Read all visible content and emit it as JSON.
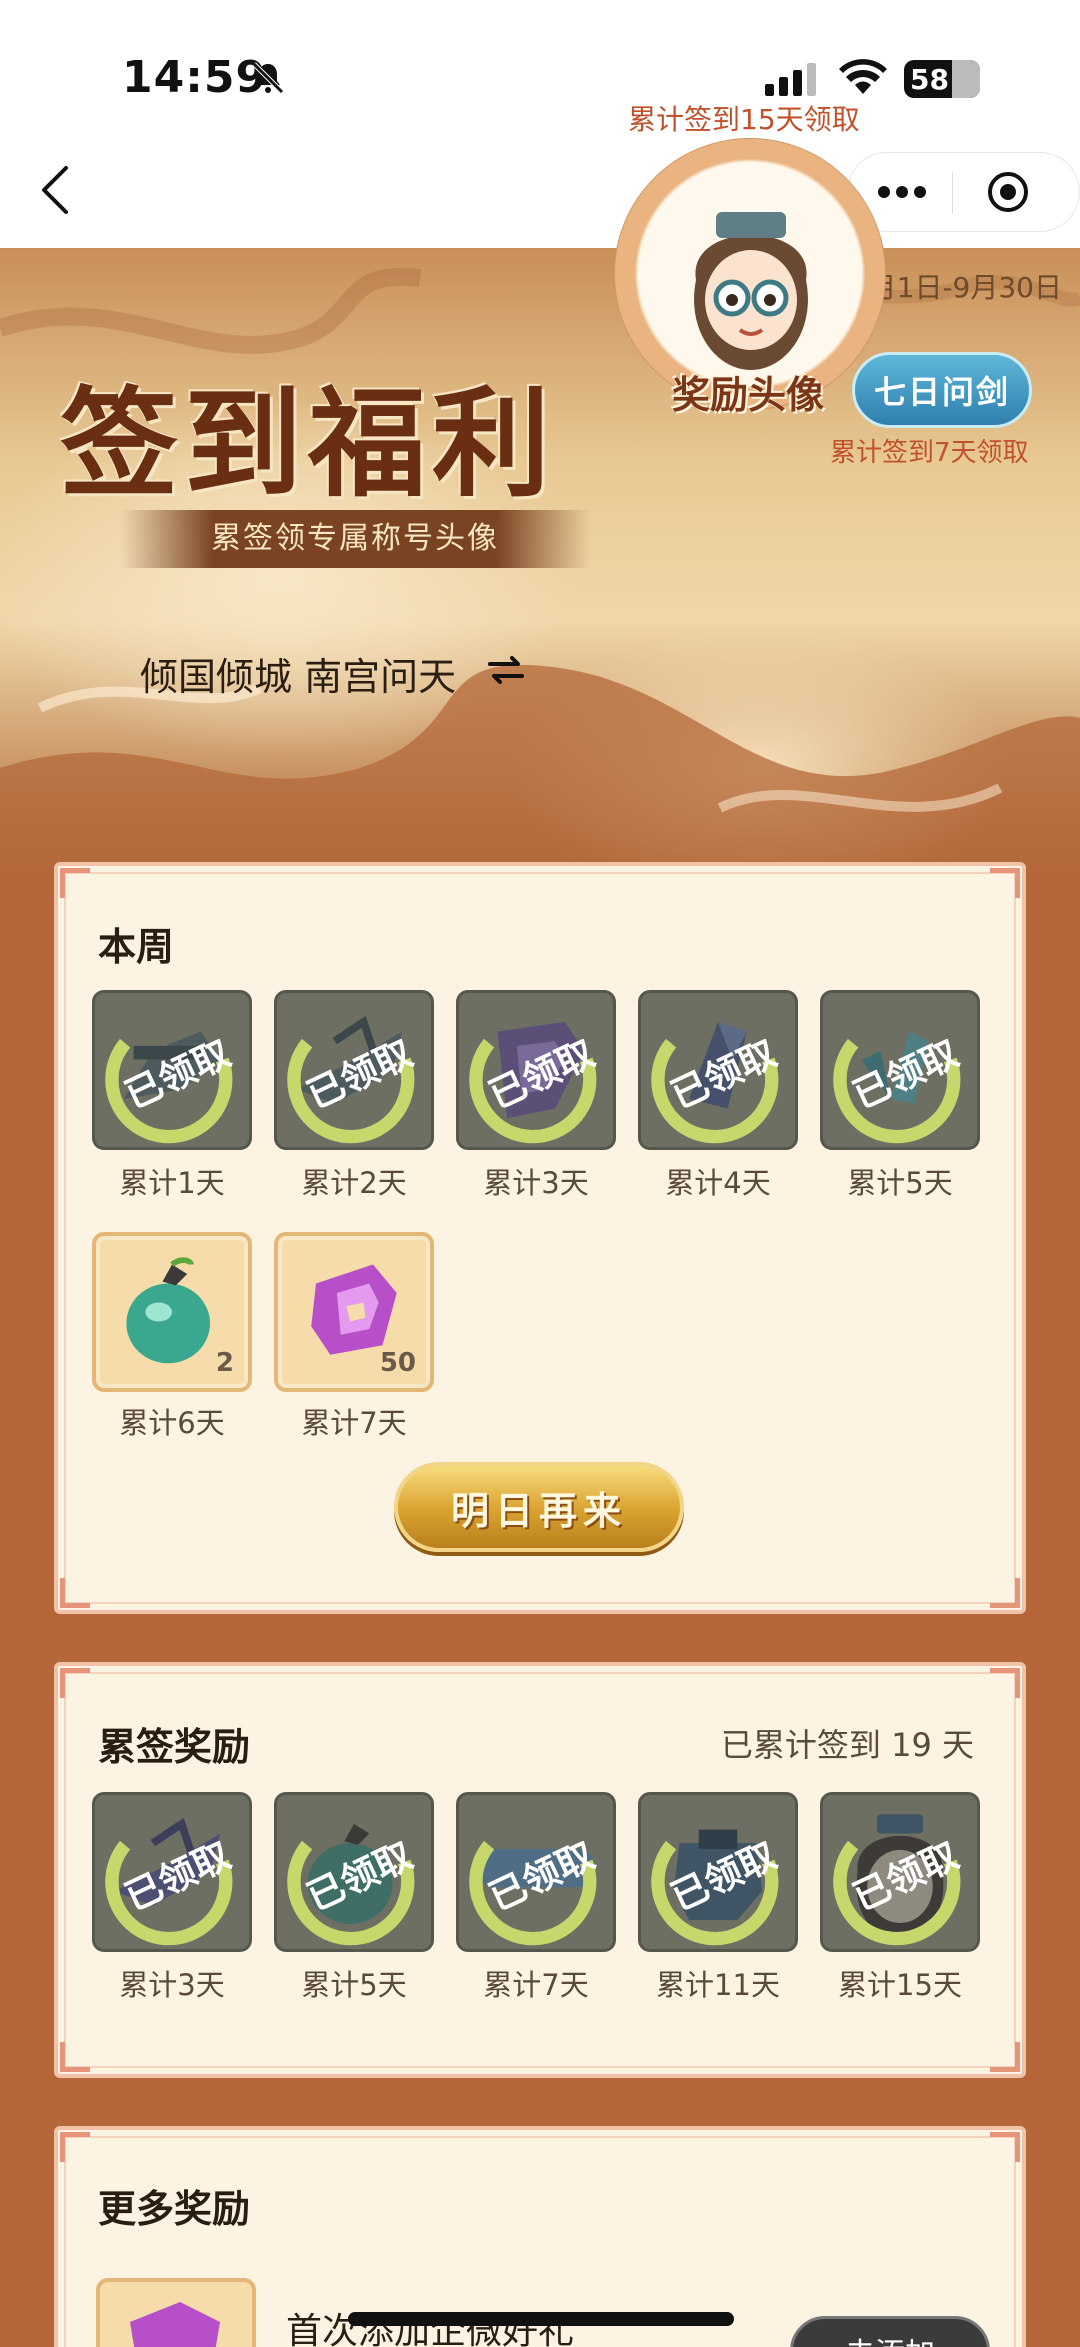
{
  "status_bar": {
    "time": "14:59",
    "battery": "58"
  },
  "banner": {
    "activity_time": "本期活动时间：9月1日-9月30日",
    "title": "签到福利",
    "subtitle": "累签领专属称号头像",
    "player_name": "倾国倾城  南宫问天",
    "avatar_note_top": "累计签到15天领取",
    "avatar_label": "奖励头像",
    "title_badge": "七日问剑",
    "avatar_note_bottom": "累计签到7天领取"
  },
  "weekly": {
    "title": "本周",
    "items": [
      {
        "label": "累计1天",
        "state": "claimed",
        "icon": "gray-sword-icon",
        "stamp": "已领取"
      },
      {
        "label": "累计2天",
        "state": "claimed",
        "icon": "gray-sword-icon",
        "stamp": "已领取"
      },
      {
        "label": "累计3天",
        "state": "claimed",
        "icon": "purple-gem-icon",
        "stamp": "已领取"
      },
      {
        "label": "累计4天",
        "state": "claimed",
        "icon": "crystal-icon",
        "stamp": "已领取"
      },
      {
        "label": "累计5天",
        "state": "claimed",
        "icon": "teal-crystal-icon",
        "stamp": "已领取"
      },
      {
        "label": "累计6天",
        "state": "pending",
        "icon": "green-pouch-icon",
        "qty": "2"
      },
      {
        "label": "累计7天",
        "state": "pending",
        "icon": "purple-gem-icon",
        "qty": "50"
      }
    ],
    "cta": "明日再来"
  },
  "cumulative": {
    "title": "累签奖励",
    "summary": "已累计签到 19 天",
    "items": [
      {
        "label": "累计3天",
        "stamp": "已领取",
        "icon": "gray-sword-icon"
      },
      {
        "label": "累计5天",
        "stamp": "已领取",
        "icon": "green-pouch-icon"
      },
      {
        "label": "累计7天",
        "stamp": "已领取",
        "icon": "title-badge-icon"
      },
      {
        "label": "累计11天",
        "stamp": "已领取",
        "icon": "armor-icon"
      },
      {
        "label": "累计15天",
        "stamp": "已领取",
        "icon": "avatar-icon"
      }
    ]
  },
  "more": {
    "title": "更多奖励",
    "item_title": "首次添加企微好礼",
    "button": "去添加"
  },
  "colors": {
    "stamp_green": "#c6d86b",
    "accent_brown": "#6a2f12",
    "card_bg": "#fcf3e3"
  }
}
